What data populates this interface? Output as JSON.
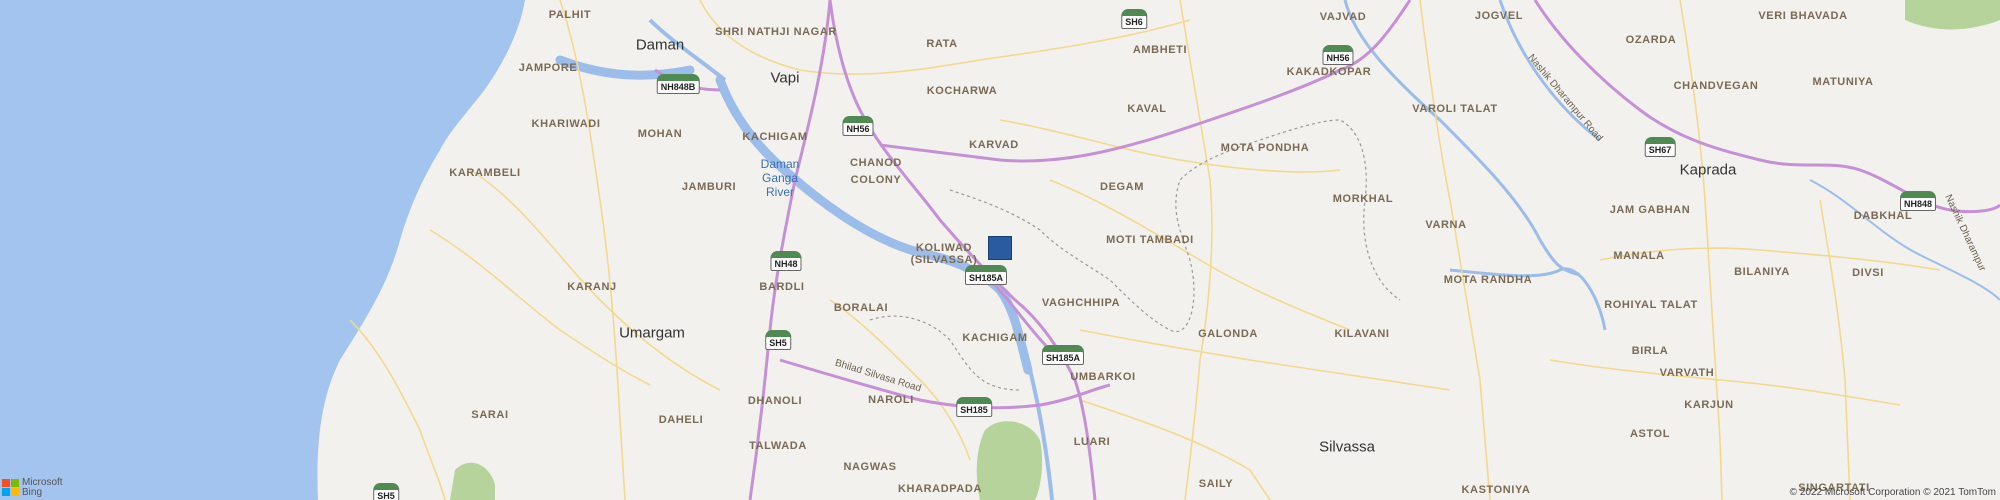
{
  "map": {
    "colors": {
      "land": "#f2f1ee",
      "sea": "#a3c4ef",
      "river": "#9cbde9",
      "major_road": "#c690d6",
      "minor_road": "#f3d890",
      "forest": "#b5d39a",
      "pin": "#2a5aa0"
    },
    "cities": [
      "Daman",
      "Vapi",
      "Umargam",
      "Kaprada",
      "Silvassa"
    ],
    "localities": [
      "PALHIT",
      "SHRI NATHJI NAGAR",
      "RATA",
      "AMBHETI",
      "VAJVAD",
      "JOGVEL",
      "VERI BHAVADA",
      "OZARDA",
      "JAMPORE",
      "KOCHARWA",
      "KAVAL",
      "KAKADKOPAR",
      "CHANDVEGAN",
      "MATUNIYA",
      "KHARIWADI",
      "MOHAN",
      "KACHIGAM",
      "KARVAD",
      "VAROLI TALAT",
      "MOTA PONDHA",
      "KARAMBELI",
      "JAMBURI",
      "CHANOD",
      "COLONY",
      "DEGAM",
      "MORKHAL",
      "JAM GABHAN",
      "DABKHAL",
      "VARNA",
      "KOLIWAD",
      "(SILVASSA)",
      "MOTI TAMBADI",
      "MOTA RANDHA",
      "MANALA",
      "BILANIYA",
      "DIVSI",
      "KARANJ",
      "BARDLI",
      "BORALAI",
      "VAGHCHHIPA",
      "ROHIYAL TALAT",
      "KACHIGAM",
      "GALONDA",
      "KILAVANI",
      "BIRLA",
      "UMBARKOI",
      "VARVATH",
      "SARAI",
      "DAHELI",
      "DHANOLI",
      "NAROLI",
      "LUARI",
      "ASTOL",
      "KARJUN",
      "TALWADA",
      "NAGWAS",
      "KHARADPADA",
      "SAILY",
      "KASTONIYA",
      "SINGARTATI"
    ],
    "rivers": [
      "Daman",
      "Ganga",
      "River"
    ],
    "road_names": [
      "Nashik Dharampur Road",
      "Bhilad Silvasa Road",
      "Nashik Dharampur"
    ],
    "shields": [
      "SH6",
      "NH56",
      "NH848B",
      "NH56",
      "SH67",
      "NH848",
      "NH48",
      "SH185A",
      "SH5",
      "SH185A",
      "SH185",
      "SH5"
    ],
    "pin_label": "Selected location",
    "attribution": {
      "brand_line1": "Microsoft",
      "brand_line2": "Bing",
      "copyright": "© 2022 Microsoft Corporation © 2021 TomTom"
    }
  }
}
